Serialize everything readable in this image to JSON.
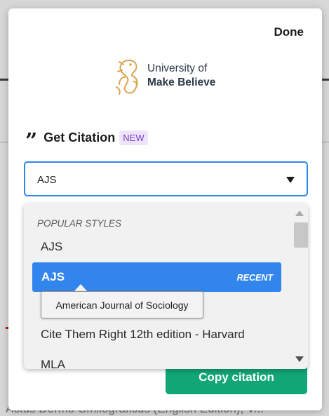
{
  "background": {
    "bottom_text": "Actus Dermo-Smilograficus (English Edition), V..."
  },
  "modal": {
    "done_label": "Done",
    "logo": {
      "line1": "University of",
      "line2": "Make Believe",
      "icon": "seahorse-logo-icon"
    },
    "heading": {
      "icon": "quote-icon",
      "quote_glyph": "”",
      "title": "Get Citation",
      "badge": "NEW"
    },
    "select": {
      "value": "AJS"
    },
    "copy_label": "Copy citation"
  },
  "dropdown": {
    "group_label": "POPULAR STYLES",
    "options": [
      {
        "label": "AJS"
      },
      {
        "label": "AJS",
        "tag": "RECENT",
        "selected": true
      },
      {
        "label": "Cite Them Right 12th edition - Harvard"
      },
      {
        "label": "MLA"
      }
    ],
    "tooltip": "American Journal of Sociology"
  },
  "colors": {
    "accent_blue": "#3285ec",
    "select_border": "#2f86eb",
    "copy_green": "#12a578",
    "badge_bg": "#efe5fb",
    "badge_text": "#7a3fcb"
  }
}
